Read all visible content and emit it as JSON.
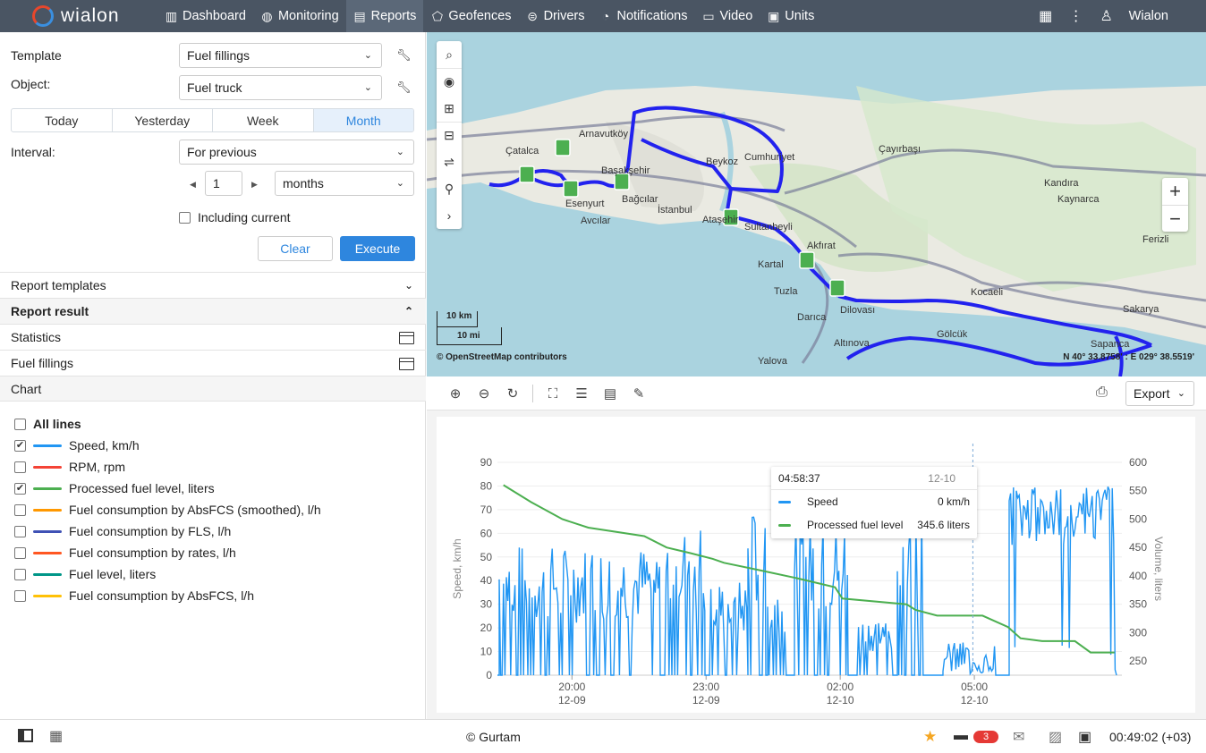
{
  "brand": {
    "name": "wialon"
  },
  "nav": [
    {
      "label": "Dashboard",
      "icon": "dashboard-icon"
    },
    {
      "label": "Monitoring",
      "icon": "globe-icon"
    },
    {
      "label": "Reports",
      "icon": "reports-icon"
    },
    {
      "label": "Geofences",
      "icon": "geofence-icon"
    },
    {
      "label": "Drivers",
      "icon": "steering-wheel-icon"
    },
    {
      "label": "Notifications",
      "icon": "bell-icon"
    },
    {
      "label": "Video",
      "icon": "video-icon"
    },
    {
      "label": "Units",
      "icon": "truck-icon"
    }
  ],
  "user": {
    "name": "Wialon"
  },
  "report_form": {
    "template_label": "Template",
    "template_value": "Fuel fillings",
    "object_label": "Object:",
    "object_value": "Fuel truck",
    "periods": [
      "Today",
      "Yesterday",
      "Week",
      "Month"
    ],
    "active_period": "Month",
    "interval_label": "Interval:",
    "interval_value": "For previous",
    "interval_count": "1",
    "interval_unit": "months",
    "including_current": "Including current",
    "clear": "Clear",
    "execute": "Execute"
  },
  "sections": {
    "report_templates": "Report templates",
    "report_result": "Report result",
    "statistics": "Statistics",
    "fuel_fillings": "Fuel fillings",
    "chart": "Chart"
  },
  "legend": {
    "all_lines": "All lines",
    "items": [
      {
        "label": "Speed, km/h",
        "color": "#2196f3",
        "checked": true
      },
      {
        "label": "RPM, rpm",
        "color": "#f44336",
        "checked": false
      },
      {
        "label": "Processed fuel level, liters",
        "color": "#4caf50",
        "checked": true
      },
      {
        "label": "Fuel consumption by AbsFCS (smoothed), l/h",
        "color": "#ff9800",
        "checked": false
      },
      {
        "label": "Fuel consumption by FLS, l/h",
        "color": "#3f51b5",
        "checked": false
      },
      {
        "label": "Fuel consumption by rates, l/h",
        "color": "#ff5722",
        "checked": false
      },
      {
        "label": "Fuel level, liters",
        "color": "#009688",
        "checked": false
      },
      {
        "label": "Fuel consumption by AbsFCS, l/h",
        "color": "#ffc107",
        "checked": false
      }
    ]
  },
  "map": {
    "places": [
      "Arnavutköy",
      "Çatalca",
      "Başakşehir",
      "Esenyurt",
      "Bağcılar",
      "İstanbul",
      "Avcılar",
      "Beykoz",
      "Cumhuriyet",
      "Çayırbaşı",
      "Kandıra",
      "Kaynarca",
      "Ferizli",
      "Ataşehir",
      "Sultanbeyli",
      "Akfırat",
      "Kartal",
      "Tuzla",
      "Dilovası",
      "Kocaeli",
      "Darıca",
      "Gölcük",
      "Sakarya",
      "Sapanca",
      "Altınova",
      "Yalova"
    ],
    "scale_km": "10 km",
    "scale_mi": "10 mi",
    "attribution": "© OpenStreetMap contributors",
    "coordinates": "N 40° 33.8758' : E 029° 38.5519'"
  },
  "chart_toolbar": {
    "export": "Export"
  },
  "chart_data": {
    "type": "line",
    "ylabel_left": "Speed, km/h",
    "ylabel_right": "Volume, liters",
    "yticks_left": [
      "0",
      "10",
      "20",
      "30",
      "40",
      "50",
      "60",
      "70",
      "80",
      "90"
    ],
    "yticks_right": [
      "250",
      "300",
      "350",
      "400",
      "450",
      "500",
      "550",
      "600"
    ],
    "ylim_left": [
      0,
      90
    ],
    "ylim_right": [
      225,
      600
    ],
    "x_ticks": [
      {
        "time": "20:00",
        "date": "12-09"
      },
      {
        "time": "23:00",
        "date": "12-09"
      },
      {
        "time": "02:00",
        "date": "12-10"
      },
      {
        "time": "05:00",
        "date": "12-10"
      }
    ],
    "series": [
      {
        "name": "Speed",
        "unit": "km/h",
        "color": "#2196f3"
      },
      {
        "name": "Processed fuel level",
        "unit": "liters",
        "color": "#4caf50",
        "x": [
          "18:28",
          "19:05",
          "19:47",
          "20:22",
          "21:37",
          "22:07",
          "22:39",
          "23:09",
          "23:24",
          "00:12",
          "01:05",
          "01:53",
          "02:03",
          "03:29",
          "03:41",
          "04:10",
          "04:48",
          "05:11",
          "05:45",
          "06:02",
          "06:31",
          "07:15",
          "07:36",
          "08:08"
        ],
        "y": [
          560,
          530,
          500,
          485,
          470,
          450,
          440,
          430,
          423,
          410,
          395,
          380,
          360,
          350,
          340,
          330,
          330,
          330,
          310,
          290,
          285,
          285,
          265,
          265
        ]
      }
    ],
    "tooltip": {
      "time": "04:58:37",
      "date": "12-10",
      "speed_label": "Speed",
      "speed_value": "0 km/h",
      "fuel_label": "Processed fuel level",
      "fuel_value": "345.6 liters"
    }
  },
  "footer": {
    "copyright": "© Gurtam",
    "messages_count": "3",
    "clock": "00:49:02 (+03)"
  }
}
